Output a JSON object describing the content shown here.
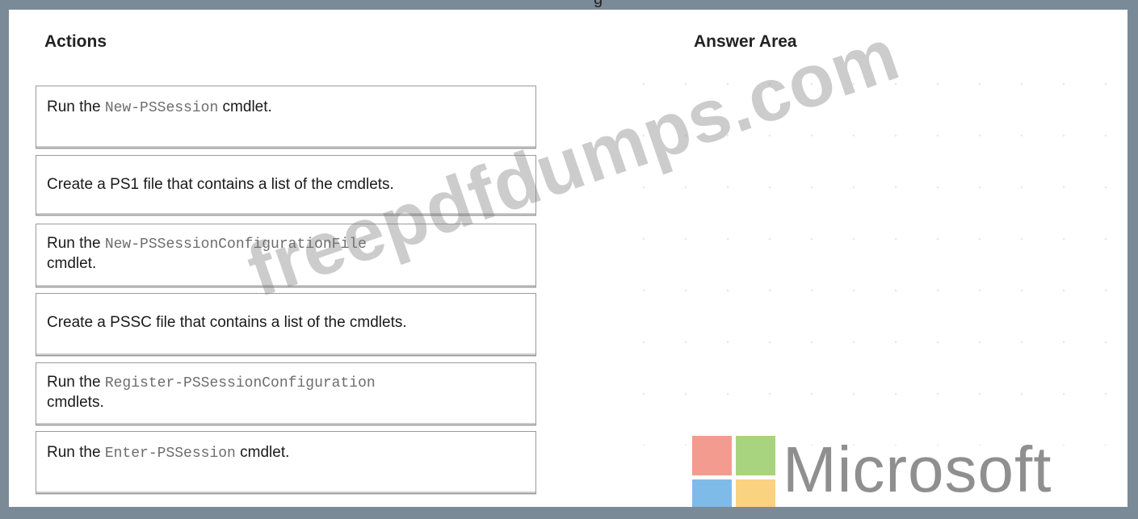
{
  "top_fragment": "g",
  "actions_heading": "Actions",
  "answer_heading": "Answer Area",
  "actions": [
    {
      "prefix": "Run the ",
      "code": "New-PSSession",
      "suffix": "  cmdlet."
    },
    {
      "prefix": "Create a PS1 file that contains a list of the cmdlets.",
      "code": "",
      "suffix": ""
    },
    {
      "prefix": "Run the ",
      "code": "New-PSSessionConfigurationFile",
      "suffix": "cmdlet."
    },
    {
      "prefix": "Create a PSSC file that contains a list of the cmdlets.",
      "code": "",
      "suffix": ""
    },
    {
      "prefix": "Run the ",
      "code": "Register-PSSessionConfiguration",
      "suffix": "cmdlets."
    },
    {
      "prefix": "Run the ",
      "code": "Enter-PSSession",
      "suffix": " cmdlet."
    }
  ],
  "watermark": "freepdfdumps.com",
  "logo_text": "Microsoft",
  "colors": {
    "frame": "#7b8a97",
    "logo_red": "#f29b8e",
    "logo_green": "#a8d37f",
    "logo_blue": "#7fbbe8",
    "logo_yellow": "#fbd27f"
  }
}
